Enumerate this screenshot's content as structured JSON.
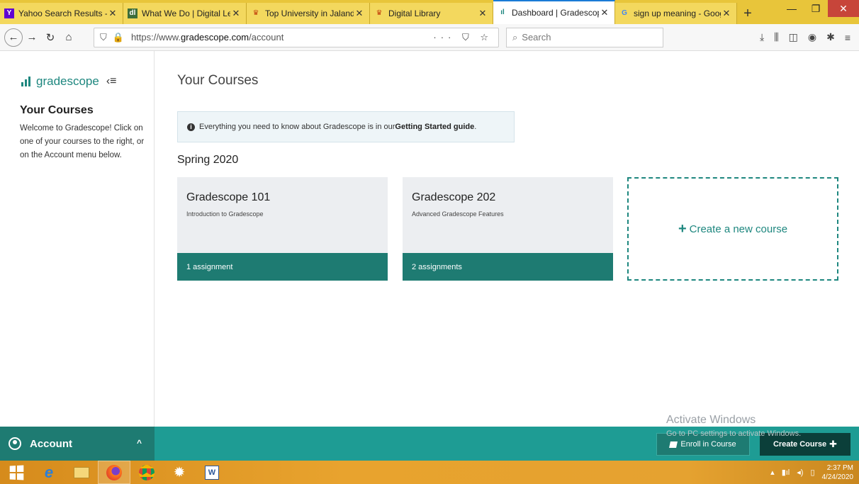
{
  "browser": {
    "tabs": [
      {
        "title": "Yahoo Search Results - W",
        "icon": "yahoo-icon",
        "active": false
      },
      {
        "title": "What We Do | Digital Lea",
        "icon": "digital-learning-icon",
        "active": false
      },
      {
        "title": "Top University in Jalandh",
        "icon": "university-icon",
        "active": false
      },
      {
        "title": "Digital Library",
        "icon": "library-icon",
        "active": false
      },
      {
        "title": "Dashboard | Gradescope",
        "icon": "gradescope-icon",
        "active": true
      },
      {
        "title": "sign up meaning - Googl",
        "icon": "google-icon",
        "active": false
      }
    ],
    "new_tab": "+",
    "url_prefix": "https://www.",
    "url_domain": "gradescope.com",
    "url_path": "/account",
    "url_actions": "··· ⛉ ☆",
    "search_placeholder": "Search"
  },
  "sidebar": {
    "brand": "gradescope",
    "title": "Your Courses",
    "text": "Welcome to Gradescope! Click on one of your courses to the right, or on the Account menu below."
  },
  "main": {
    "title": "Your Courses",
    "notice_prefix": "Everything you need to know about Gradescope is in our ",
    "notice_link": "Getting Started guide",
    "notice_suffix": ".",
    "term": "Spring 2020",
    "courses": [
      {
        "name": "Gradescope 101",
        "description": "Introduction to Gradescope",
        "assignments": "1 assignment"
      },
      {
        "name": "Gradescope 202",
        "description": "Advanced Gradescope Features",
        "assignments": "2 assignments"
      }
    ],
    "create_new": "Create a new course"
  },
  "bottom": {
    "account": "Account",
    "enroll": "Enroll in Course",
    "create": "Create Course"
  },
  "watermark": {
    "line1": "Activate Windows",
    "line2": "Go to PC settings to activate Windows."
  },
  "taskbar": {
    "time": "2:37 PM",
    "date": "4/24/2020"
  },
  "colors": {
    "accent": "#1e877f",
    "card_footer": "#1e7b72",
    "bottom_bar": "#1e9c94",
    "create_button": "#0b3f3a",
    "taskbar": "#e8a32e"
  }
}
